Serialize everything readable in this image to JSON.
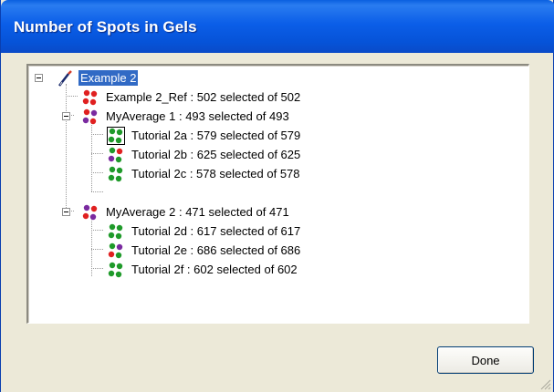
{
  "window": {
    "title": "Number of Spots in Gels"
  },
  "tree": {
    "root": {
      "label": "Example 2",
      "icon": "wand-icon"
    },
    "items": [
      {
        "label": "Example 2_Ref : 502 selected of 502",
        "icon": "spots-icon-red"
      },
      {
        "label": "MyAverage 1 : 493 selected of 493",
        "icon": "spots-icon-multi"
      },
      {
        "label": "Tutorial 2a : 579 selected of 579",
        "icon": "spots-icon-green"
      },
      {
        "label": "Tutorial 2b : 625 selected of 625",
        "icon": "spots-icon-multi"
      },
      {
        "label": "Tutorial 2c : 578 selected of 578",
        "icon": "spots-icon-green"
      },
      {
        "label": "MyAverage 2 : 471 selected of 471",
        "icon": "spots-icon-multi"
      },
      {
        "label": "Tutorial 2d : 617 selected of 617",
        "icon": "spots-icon-green"
      },
      {
        "label": "Tutorial 2e : 686 selected of 686",
        "icon": "spots-icon-multi"
      },
      {
        "label": "Tutorial 2f : 602 selected of 602",
        "icon": "spots-icon-green"
      }
    ]
  },
  "buttons": {
    "done_label": "Done"
  },
  "colors": {
    "title_bar": "#0b5ee8",
    "selection": "#316ac5",
    "dialog_bg": "#ece9d8"
  }
}
